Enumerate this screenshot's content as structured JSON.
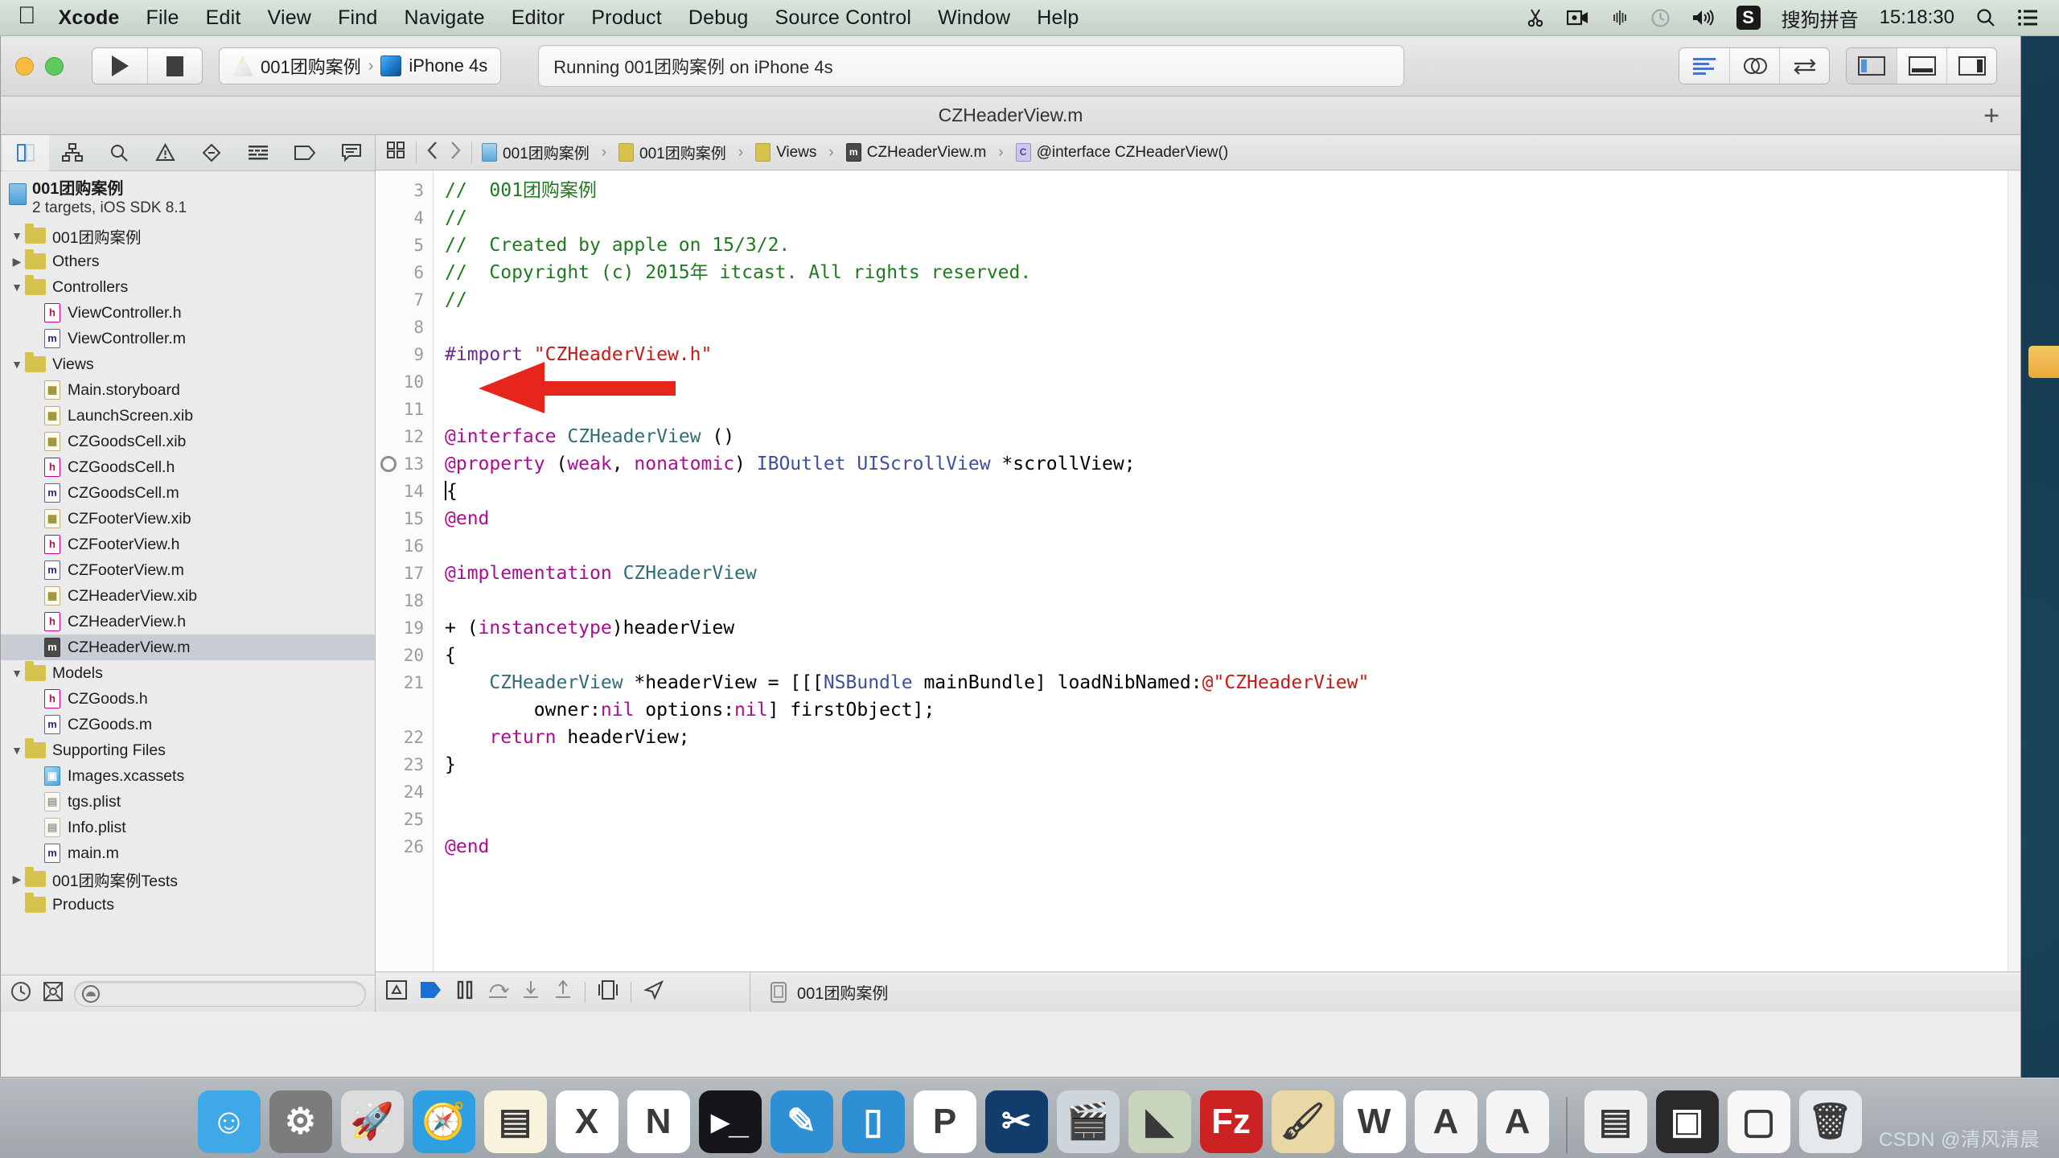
{
  "menubar": {
    "apple_icon": "apple-logo",
    "items": [
      {
        "label": "Xcode",
        "bold": true
      },
      {
        "label": "File",
        "bold": false
      },
      {
        "label": "Edit",
        "bold": false
      },
      {
        "label": "View",
        "bold": false
      },
      {
        "label": "Find",
        "bold": false
      },
      {
        "label": "Navigate",
        "bold": false
      },
      {
        "label": "Editor",
        "bold": false
      },
      {
        "label": "Product",
        "bold": false
      },
      {
        "label": "Debug",
        "bold": false
      },
      {
        "label": "Source Control",
        "bold": false
      },
      {
        "label": "Window",
        "bold": false
      },
      {
        "label": "Help",
        "bold": false
      }
    ],
    "status": {
      "scissors_icon": "scissors-icon",
      "screen_record_icon": "screen-record-icon",
      "airdrop_icon": "airdrop-icon",
      "timemachine_icon": "time-machine-icon",
      "volume_icon": "volume-icon",
      "input_badge": "S",
      "input_method": "搜狗拼音",
      "clock": "15:18:30",
      "search_icon": "spotlight-search-icon",
      "notification_icon": "notification-center-icon"
    }
  },
  "toolbar": {
    "run_icon": "run-play-icon",
    "stop_icon": "stop-square-icon",
    "scheme": {
      "project_icon": "xcode-target-icon",
      "project_name": "001团购案例",
      "separator": "›",
      "device_icon": "simulator-device-icon",
      "device_name": "iPhone 4s"
    },
    "activity_status": "Running 001团购案例 on iPhone 4s",
    "editor_buttons": [
      {
        "name": "standard-editor-button",
        "selected": true
      },
      {
        "name": "assistant-editor-button",
        "selected": false
      },
      {
        "name": "version-editor-button",
        "selected": false
      }
    ],
    "view_buttons": [
      {
        "name": "toggle-navigator-button",
        "selected": true
      },
      {
        "name": "toggle-debug-area-button",
        "selected": false
      },
      {
        "name": "toggle-utilities-button",
        "selected": false
      }
    ]
  },
  "window": {
    "title": "CZHeaderView.m",
    "add_tab_label": "+"
  },
  "navigator": {
    "tabs": [
      {
        "name": "project-navigator-tab",
        "icon": "folder-tree-icon",
        "active": true
      },
      {
        "name": "symbol-navigator-tab",
        "icon": "hierarchy-icon",
        "active": false
      },
      {
        "name": "find-navigator-tab",
        "icon": "magnifier-icon",
        "active": false
      },
      {
        "name": "issue-navigator-tab",
        "icon": "warning-triangle-icon",
        "active": false
      },
      {
        "name": "test-navigator-tab",
        "icon": "diamond-minus-icon",
        "active": false
      },
      {
        "name": "debug-navigator-tab",
        "icon": "debug-gauge-icon",
        "active": false
      },
      {
        "name": "breakpoint-navigator-tab",
        "icon": "breakpoint-tag-icon",
        "active": false
      },
      {
        "name": "log-navigator-tab",
        "icon": "speech-bubble-icon",
        "active": false
      }
    ],
    "project": {
      "name": "001团购案例",
      "subtitle": "2 targets, iOS SDK 8.1"
    },
    "tree": [
      {
        "label": "001团购案例",
        "kind": "folder",
        "indent": 0,
        "twisty": "open",
        "selected": false
      },
      {
        "label": "Others",
        "kind": "folder",
        "indent": 1,
        "twisty": "closed",
        "selected": false
      },
      {
        "label": "Controllers",
        "kind": "folder",
        "indent": 1,
        "twisty": "open",
        "selected": false
      },
      {
        "label": "ViewController.h",
        "kind": "h",
        "indent": 2,
        "twisty": "none",
        "selected": false
      },
      {
        "label": "ViewController.m",
        "kind": "m",
        "indent": 2,
        "twisty": "none",
        "selected": false
      },
      {
        "label": "Views",
        "kind": "folder",
        "indent": 1,
        "twisty": "open",
        "selected": false
      },
      {
        "label": "Main.storyboard",
        "kind": "sb",
        "indent": 2,
        "twisty": "none",
        "selected": false
      },
      {
        "label": "LaunchScreen.xib",
        "kind": "xib",
        "indent": 2,
        "twisty": "none",
        "selected": false
      },
      {
        "label": "CZGoodsCell.xib",
        "kind": "xib",
        "indent": 2,
        "twisty": "none",
        "selected": false
      },
      {
        "label": "CZGoodsCell.h",
        "kind": "h",
        "indent": 2,
        "twisty": "none",
        "selected": false
      },
      {
        "label": "CZGoodsCell.m",
        "kind": "m",
        "indent": 2,
        "twisty": "none",
        "selected": false
      },
      {
        "label": "CZFooterView.xib",
        "kind": "xib",
        "indent": 2,
        "twisty": "none",
        "selected": false
      },
      {
        "label": "CZFooterView.h",
        "kind": "h",
        "indent": 2,
        "twisty": "none",
        "selected": false
      },
      {
        "label": "CZFooterView.m",
        "kind": "m",
        "indent": 2,
        "twisty": "none",
        "selected": false
      },
      {
        "label": "CZHeaderView.xib",
        "kind": "xib",
        "indent": 2,
        "twisty": "none",
        "selected": false
      },
      {
        "label": "CZHeaderView.h",
        "kind": "h",
        "indent": 2,
        "twisty": "none",
        "selected": false
      },
      {
        "label": "CZHeaderView.m",
        "kind": "m",
        "indent": 2,
        "twisty": "none",
        "selected": true
      },
      {
        "label": "Models",
        "kind": "folder",
        "indent": 1,
        "twisty": "open",
        "selected": false
      },
      {
        "label": "CZGoods.h",
        "kind": "h",
        "indent": 2,
        "twisty": "none",
        "selected": false
      },
      {
        "label": "CZGoods.m",
        "kind": "m",
        "indent": 2,
        "twisty": "none",
        "selected": false
      },
      {
        "label": "Supporting Files",
        "kind": "folder",
        "indent": 1,
        "twisty": "open",
        "selected": false
      },
      {
        "label": "Images.xcassets",
        "kind": "xcassets",
        "indent": 2,
        "twisty": "none",
        "selected": false
      },
      {
        "label": "tgs.plist",
        "kind": "plist",
        "indent": 2,
        "twisty": "none",
        "selected": false
      },
      {
        "label": "Info.plist",
        "kind": "plist",
        "indent": 2,
        "twisty": "none",
        "selected": false
      },
      {
        "label": "main.m",
        "kind": "m",
        "indent": 2,
        "twisty": "none",
        "selected": false
      },
      {
        "label": "001团购案例Tests",
        "kind": "folder",
        "indent": 0,
        "twisty": "closed",
        "selected": false
      },
      {
        "label": "Products",
        "kind": "folder",
        "indent": 0,
        "twisty": "none",
        "selected": false
      }
    ],
    "filter": {
      "recent_icon": "clock-recent-icon",
      "sourcecontrol_icon": "source-control-filter-icon",
      "placeholder": "",
      "value": "",
      "search_icon": "filter-search-icon"
    }
  },
  "jumpbar": {
    "related_items_icon": "related-items-icon",
    "back_icon": "chevron-left-icon",
    "forward_icon": "chevron-right-icon",
    "crumbs": [
      {
        "label": "001团购案例",
        "icon": "project-icon"
      },
      {
        "label": "001团购案例",
        "icon": "folder-icon"
      },
      {
        "label": "Views",
        "icon": "folder-icon"
      },
      {
        "label": "CZHeaderView.m",
        "icon": "objc-m-file-icon"
      },
      {
        "label": "@interface CZHeaderView()",
        "icon": "interface-symbol-icon"
      }
    ],
    "separator": "›"
  },
  "code": {
    "first_visible_line": 3,
    "breakpoint_line": 13,
    "cursor_line": 14,
    "lines": [
      {
        "n": 3,
        "text": "//  001团购案例",
        "style": "comment"
      },
      {
        "n": 4,
        "text": "//",
        "style": "comment"
      },
      {
        "n": 5,
        "text": "//  Created by apple on 15/3/2.",
        "style": "comment"
      },
      {
        "n": 6,
        "text": "//  Copyright (c) 2015年 itcast. All rights reserved.",
        "style": "comment"
      },
      {
        "n": 7,
        "text": "//",
        "style": "comment"
      },
      {
        "n": 8,
        "text": "",
        "style": "plain"
      },
      {
        "n": 9,
        "text": "#import \"CZHeaderView.h\"",
        "style": "import"
      },
      {
        "n": 10,
        "text": "",
        "style": "plain"
      },
      {
        "n": 11,
        "text": "",
        "style": "plain"
      },
      {
        "n": 12,
        "text": "@interface CZHeaderView ()",
        "style": "interface"
      },
      {
        "n": 13,
        "text": "@property (weak, nonatomic) IBOutlet UIScrollView *scrollView;",
        "style": "property"
      },
      {
        "n": 14,
        "text": "{",
        "style": "plain"
      },
      {
        "n": 15,
        "text": "@end",
        "style": "keyword"
      },
      {
        "n": 16,
        "text": "",
        "style": "plain"
      },
      {
        "n": 17,
        "text": "@implementation CZHeaderView",
        "style": "implementation"
      },
      {
        "n": 18,
        "text": "",
        "style": "plain"
      },
      {
        "n": 19,
        "text": "+ (instancetype)headerView",
        "style": "method"
      },
      {
        "n": 20,
        "text": "{",
        "style": "plain"
      },
      {
        "n": 21,
        "text": "    CZHeaderView *headerView = [[[NSBundle mainBundle] loadNibNamed:@\"CZHeaderView\"",
        "style": "stmt"
      },
      {
        "n": null,
        "text": "        owner:nil options:nil] firstObject];",
        "style": "stmt2"
      },
      {
        "n": 22,
        "text": "    return headerView;",
        "style": "return"
      },
      {
        "n": 23,
        "text": "}",
        "style": "plain"
      },
      {
        "n": 24,
        "text": "",
        "style": "plain"
      },
      {
        "n": 25,
        "text": "",
        "style": "plain"
      },
      {
        "n": 26,
        "text": "@end",
        "style": "keyword"
      }
    ],
    "annotation": {
      "type": "red-arrow",
      "points_to_line": 14
    }
  },
  "debugbar": {
    "left_icons": [
      {
        "name": "breakpoint-list-icon"
      },
      {
        "name": "continue-execution-icon"
      },
      {
        "name": "pause-icon"
      },
      {
        "name": "step-over-icon"
      },
      {
        "name": "step-into-icon"
      },
      {
        "name": "step-out-icon"
      },
      {
        "name": "view-debugging-icon"
      },
      {
        "name": "location-simulate-icon"
      }
    ],
    "process_icon": "process-icon",
    "process_label": "001团购案例"
  },
  "dock": {
    "apps": [
      {
        "name": "finder",
        "glyph": "☺",
        "bg": "#3fa9e8"
      },
      {
        "name": "system-preferences",
        "glyph": "⚙",
        "bg": "#7c7c7c"
      },
      {
        "name": "launchpad",
        "glyph": "🚀",
        "bg": "#dcdcdc"
      },
      {
        "name": "safari",
        "glyph": "🧭",
        "bg": "#2e9fe0"
      },
      {
        "name": "notes",
        "glyph": "▤",
        "bg": "#f7f3dc"
      },
      {
        "name": "microsoft-excel",
        "glyph": "X",
        "bg": "#ffffff"
      },
      {
        "name": "microsoft-onenote",
        "glyph": "N",
        "bg": "#ffffff"
      },
      {
        "name": "terminal",
        "glyph": "▸_",
        "bg": "#15151a"
      },
      {
        "name": "xcode",
        "glyph": "✎",
        "bg": "#2e8fd4"
      },
      {
        "name": "ios-simulator",
        "glyph": "▯",
        "bg": "#2e8fd4"
      },
      {
        "name": "parallels-desktop",
        "glyph": "P",
        "bg": "#ffffff"
      },
      {
        "name": "snipaste-tool",
        "glyph": "✂",
        "bg": "#123c6b"
      },
      {
        "name": "quicktime-player",
        "glyph": "🎬",
        "bg": "#cfd6db"
      },
      {
        "name": "sublime-text",
        "glyph": "◣",
        "bg": "#c9d4bd"
      },
      {
        "name": "filezilla",
        "glyph": "Fz",
        "bg": "#cc2222"
      },
      {
        "name": "image-editor",
        "glyph": "🖌",
        "bg": "#e9d8a6"
      },
      {
        "name": "microsoft-word",
        "glyph": "W",
        "bg": "#ffffff"
      },
      {
        "name": "font-book-a",
        "glyph": "A",
        "bg": "#f4f4f4"
      },
      {
        "name": "font-book-b",
        "glyph": "A",
        "bg": "#f4f4f4"
      }
    ],
    "minimized": [
      {
        "name": "minimized-window-document",
        "glyph": "▤",
        "bg": "#f0f0f0"
      },
      {
        "name": "minimized-window-dark",
        "glyph": "▣",
        "bg": "#2a2a2a"
      },
      {
        "name": "minimized-window-blank",
        "glyph": "▢",
        "bg": "#f6f6f6"
      }
    ],
    "trash": {
      "name": "trash",
      "glyph": "🗑",
      "bg": "#e5e9ec"
    }
  },
  "watermark": "CSDN @清风清晨"
}
